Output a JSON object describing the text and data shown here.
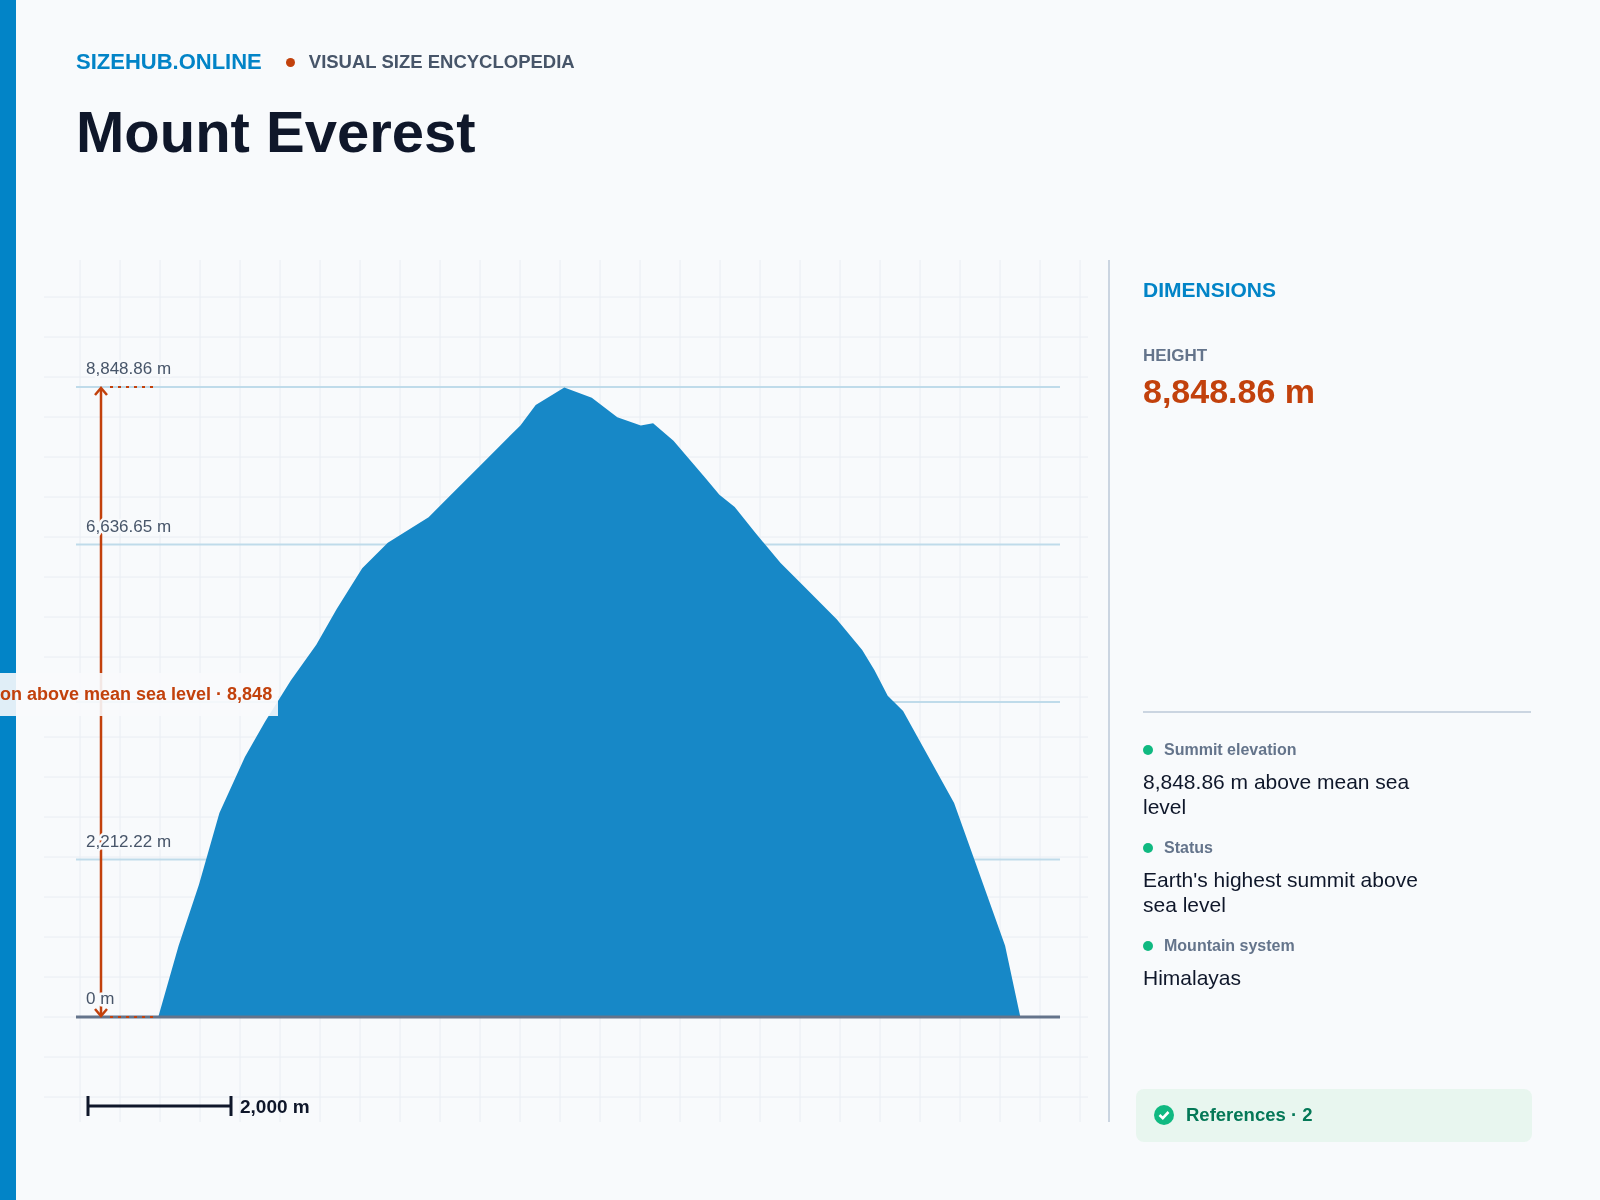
{
  "brand": "SIZEHUB.ONLINE",
  "tagline": "VISUAL SIZE ENCYCLOPEDIA",
  "title": "Mount Everest",
  "diagram": {
    "tick_labels": [
      "8,848.86 m",
      "6,636.65 m",
      "2,212.22 m",
      "0 m"
    ],
    "annotation": "on above mean sea level · 8,848",
    "scale_label": "2,000 m"
  },
  "dimensions": {
    "heading": "DIMENSIONS",
    "measure_label": "HEIGHT",
    "measure_value": "8,848.86 m",
    "facts": [
      {
        "label": "Summit elevation",
        "value": "8,848.86 m above mean sea level"
      },
      {
        "label": "Status",
        "value": "Earth's highest summit above sea level"
      },
      {
        "label": "Mountain system",
        "value": "Himalayas"
      }
    ],
    "references": "References · 2"
  }
}
